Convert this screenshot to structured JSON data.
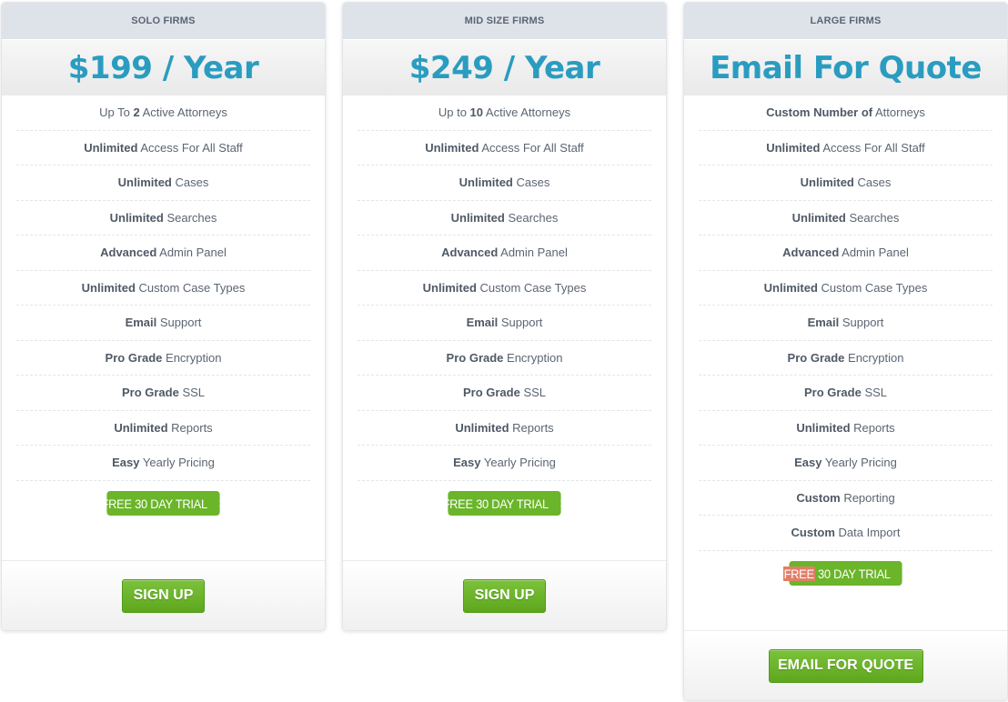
{
  "plans": [
    {
      "id": "solo",
      "tier": "SOLO FIRMS",
      "price": "$199 / Year",
      "features": [
        {
          "pre": "Up To ",
          "bold": "2",
          "post": " Active Attorneys"
        },
        {
          "pre": "",
          "bold": "Unlimited",
          "post": " Access For All Staff"
        },
        {
          "pre": "",
          "bold": "Unlimited",
          "post": " Cases"
        },
        {
          "pre": "",
          "bold": "Unlimited",
          "post": " Searches"
        },
        {
          "pre": "",
          "bold": "Advanced",
          "post": " Admin Panel"
        },
        {
          "pre": "",
          "bold": "Unlimited",
          "post": " Custom Case Types"
        },
        {
          "pre": "",
          "bold": "Email",
          "post": " Support"
        },
        {
          "pre": "",
          "bold": "Pro Grade",
          "post": " Encryption"
        },
        {
          "pre": "",
          "bold": "Pro Grade",
          "post": " SSL"
        },
        {
          "pre": "",
          "bold": "Unlimited",
          "post": " Reports"
        },
        {
          "pre": "",
          "bold": "Easy",
          "post": " Yearly Pricing"
        }
      ],
      "trial_label": {
        "first": "FREE",
        "rest": " 30 DAY TRIAL"
      },
      "trial_chevron": ">",
      "cta_label": "SIGN UP"
    },
    {
      "id": "mid",
      "tier": "MID SIZE FIRMS",
      "price": "$249 / Year",
      "features": [
        {
          "pre": "Up to ",
          "bold": "10",
          "post": " Active Attorneys"
        },
        {
          "pre": "",
          "bold": "Unlimited",
          "post": " Access For All Staff"
        },
        {
          "pre": "",
          "bold": "Unlimited",
          "post": " Cases"
        },
        {
          "pre": "",
          "bold": "Unlimited",
          "post": " Searches"
        },
        {
          "pre": "",
          "bold": "Advanced",
          "post": " Admin Panel"
        },
        {
          "pre": "",
          "bold": "Unlimited",
          "post": " Custom Case Types"
        },
        {
          "pre": "",
          "bold": "Email",
          "post": " Support"
        },
        {
          "pre": "",
          "bold": "Pro Grade",
          "post": " Encryption"
        },
        {
          "pre": "",
          "bold": "Pro Grade",
          "post": " SSL"
        },
        {
          "pre": "",
          "bold": "Unlimited",
          "post": " Reports"
        },
        {
          "pre": "",
          "bold": "Easy",
          "post": " Yearly Pricing"
        }
      ],
      "trial_label": {
        "first": "FREE",
        "rest": " 30 DAY TRIAL"
      },
      "trial_chevron": ">",
      "cta_label": "SIGN UP"
    },
    {
      "id": "large",
      "tier": "LARGE FIRMS",
      "price": "Email For Quote",
      "features": [
        {
          "pre": "",
          "bold": "Custom Number of",
          "post": " Attorneys"
        },
        {
          "pre": "",
          "bold": "Unlimited",
          "post": " Access For All Staff"
        },
        {
          "pre": "",
          "bold": "Unlimited",
          "post": " Cases"
        },
        {
          "pre": "",
          "bold": "Unlimited",
          "post": " Searches"
        },
        {
          "pre": "",
          "bold": "Advanced",
          "post": " Admin Panel"
        },
        {
          "pre": "",
          "bold": "Unlimited",
          "post": " Custom Case Types"
        },
        {
          "pre": "",
          "bold": "Email",
          "post": " Support"
        },
        {
          "pre": "",
          "bold": "Pro Grade",
          "post": " Encryption"
        },
        {
          "pre": "",
          "bold": "Pro Grade",
          "post": " SSL"
        },
        {
          "pre": "",
          "bold": "Unlimited",
          "post": " Reports"
        },
        {
          "pre": "",
          "bold": "Easy",
          "post": " Yearly Pricing"
        },
        {
          "pre": "",
          "bold": "Custom",
          "post": " Reporting"
        },
        {
          "pre": "",
          "bold": "Custom",
          "post": " Data Import"
        }
      ],
      "trial_label": {
        "first": "FREE",
        "rest": " 30 DAY TRIAL"
      },
      "trial_chevron": ">",
      "cta_label": "EMAIL FOR QUOTE"
    }
  ],
  "colors": {
    "price_accent": "#2a9cc0",
    "header_bg": "#dde3e9",
    "button_green": "#6bb52a",
    "highlight": "#e27e66"
  }
}
